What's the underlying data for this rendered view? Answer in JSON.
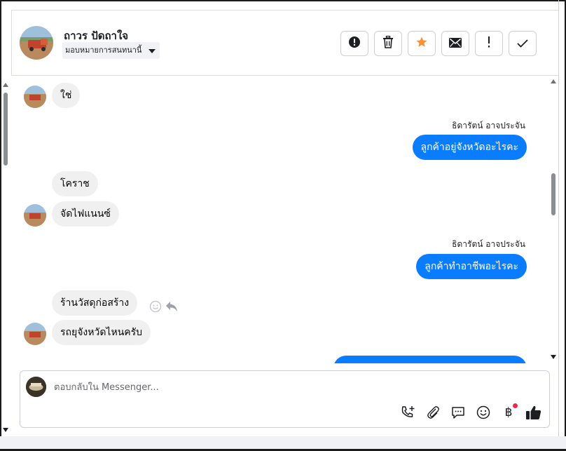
{
  "contact": {
    "name": "ถาวร ปัดถาใจ",
    "assign_label": "มอบหมายการสนทนานี้"
  },
  "header_actions": [
    {
      "name": "spam-icon",
      "label": "Mark as spam"
    },
    {
      "name": "trash-icon",
      "label": "Delete"
    },
    {
      "name": "star-icon",
      "label": "Star"
    },
    {
      "name": "envelope-icon",
      "label": "Mark as unread"
    },
    {
      "name": "exclamation-icon",
      "label": "Follow up"
    },
    {
      "name": "checkmark-icon",
      "label": "Mark as done"
    }
  ],
  "messages": {
    "m1": "ใช่",
    "sender1": "ธิดารัตน์ อาจประจัน",
    "m2": "ลูกค้าอยู่จังหวัดอะไรคะ",
    "m3": "โคราช",
    "m4": "จัดไฟแนนซ์",
    "sender2": "ธิดารัตน์ อาจประจัน",
    "m5": "ลูกค้าทำอาชีพอะไรคะ",
    "m6": "ร้านวัสดุก่อสร้าง",
    "m7": "รถยุจังหวัดไหนครับ"
  },
  "composer": {
    "placeholder": "ตอบกลับใน Messenger...",
    "tools": [
      "phone-plus-icon",
      "paperclip-icon",
      "saved-reply-icon",
      "emoji-icon",
      "baht-icon",
      "thumbs-up-icon"
    ],
    "baht_symbol": "฿"
  },
  "colors": {
    "outgoing": "#0a7cff",
    "incoming": "#f0f0f0",
    "star": "#f7923b",
    "notification_dot": "#f02849"
  }
}
